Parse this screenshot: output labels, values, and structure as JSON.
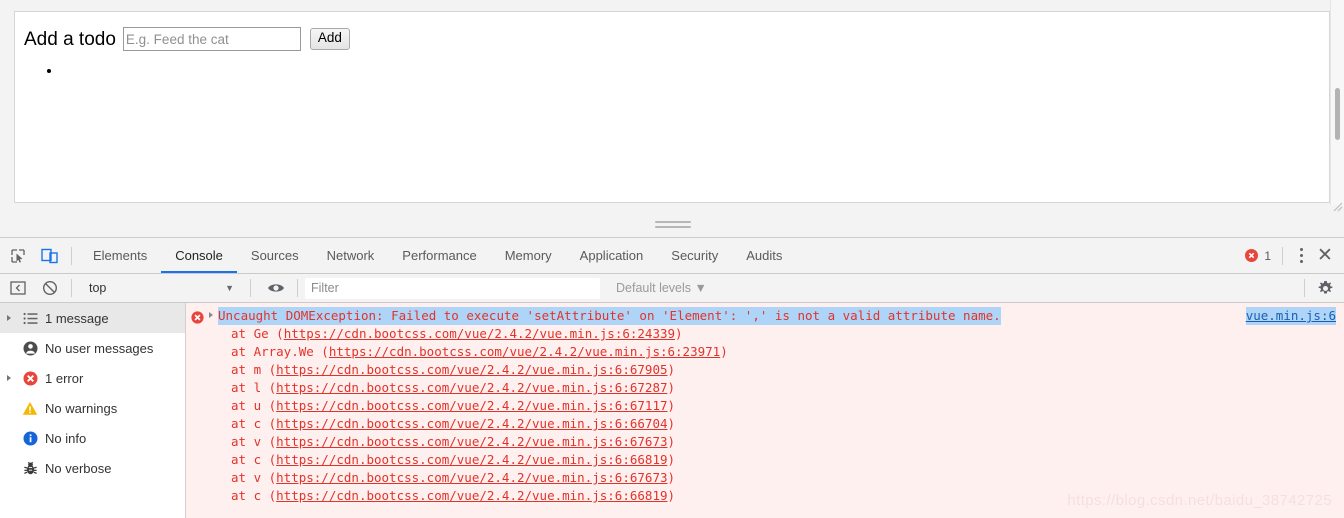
{
  "page": {
    "todo": {
      "label": "Add a todo",
      "input_placeholder": "E.g. Feed the cat",
      "input_value": "",
      "add_button": "Add",
      "items": [
        ""
      ]
    }
  },
  "devtools": {
    "tabs": [
      {
        "label": "Elements",
        "active": false
      },
      {
        "label": "Console",
        "active": true
      },
      {
        "label": "Sources",
        "active": false
      },
      {
        "label": "Network",
        "active": false
      },
      {
        "label": "Performance",
        "active": false
      },
      {
        "label": "Memory",
        "active": false
      },
      {
        "label": "Application",
        "active": false
      },
      {
        "label": "Security",
        "active": false
      },
      {
        "label": "Audits",
        "active": false
      }
    ],
    "error_badge_count": "1",
    "toolbar": {
      "context_value": "top",
      "context_caret": "▼",
      "filter_placeholder": "Filter",
      "filter_value": "",
      "levels_label": "Default levels",
      "levels_caret": "▼"
    },
    "sidebar": [
      {
        "label": "1 message",
        "icon": "list-icon",
        "selected": true,
        "has_arrow": true
      },
      {
        "label": "No user messages",
        "icon": "person-icon",
        "selected": false,
        "has_arrow": false
      },
      {
        "label": "1 error",
        "icon": "error-icon",
        "selected": false,
        "has_arrow": true
      },
      {
        "label": "No warnings",
        "icon": "warning-icon",
        "selected": false,
        "has_arrow": false
      },
      {
        "label": "No info",
        "icon": "info-icon",
        "selected": false,
        "has_arrow": false
      },
      {
        "label": "No verbose",
        "icon": "bug-icon",
        "selected": false,
        "has_arrow": false
      }
    ],
    "console": {
      "error_message": "Uncaught DOMException: Failed to execute 'setAttribute' on 'Element': ',' is not a valid attribute name.",
      "source_link": "vue.min.js:6",
      "stack": [
        {
          "prefix": "at Ge (",
          "url": "https://cdn.bootcss.com/vue/2.4.2/vue.min.js:6:24339",
          "suffix": ")"
        },
        {
          "prefix": "at Array.We (",
          "url": "https://cdn.bootcss.com/vue/2.4.2/vue.min.js:6:23971",
          "suffix": ")"
        },
        {
          "prefix": "at m (",
          "url": "https://cdn.bootcss.com/vue/2.4.2/vue.min.js:6:67905",
          "suffix": ")"
        },
        {
          "prefix": "at l (",
          "url": "https://cdn.bootcss.com/vue/2.4.2/vue.min.js:6:67287",
          "suffix": ")"
        },
        {
          "prefix": "at u (",
          "url": "https://cdn.bootcss.com/vue/2.4.2/vue.min.js:6:67117",
          "suffix": ")"
        },
        {
          "prefix": "at c (",
          "url": "https://cdn.bootcss.com/vue/2.4.2/vue.min.js:6:66704",
          "suffix": ")"
        },
        {
          "prefix": "at v (",
          "url": "https://cdn.bootcss.com/vue/2.4.2/vue.min.js:6:67673",
          "suffix": ")"
        },
        {
          "prefix": "at c (",
          "url": "https://cdn.bootcss.com/vue/2.4.2/vue.min.js:6:66819",
          "suffix": ")"
        },
        {
          "prefix": "at v (",
          "url": "https://cdn.bootcss.com/vue/2.4.2/vue.min.js:6:67673",
          "suffix": ")"
        },
        {
          "prefix": "at c (",
          "url": "https://cdn.bootcss.com/vue/2.4.2/vue.min.js:6:66819",
          "suffix": ")"
        }
      ]
    },
    "watermark": "https://blog.csdn.net/baidu_38742725"
  },
  "colors": {
    "accent_blue": "#1a73e8",
    "error_red": "#e2332a",
    "error_bg": "#fff0f0",
    "selection_blue": "#aed5f7",
    "warning_yellow": "#f5b700",
    "info_blue": "#1565d8"
  }
}
